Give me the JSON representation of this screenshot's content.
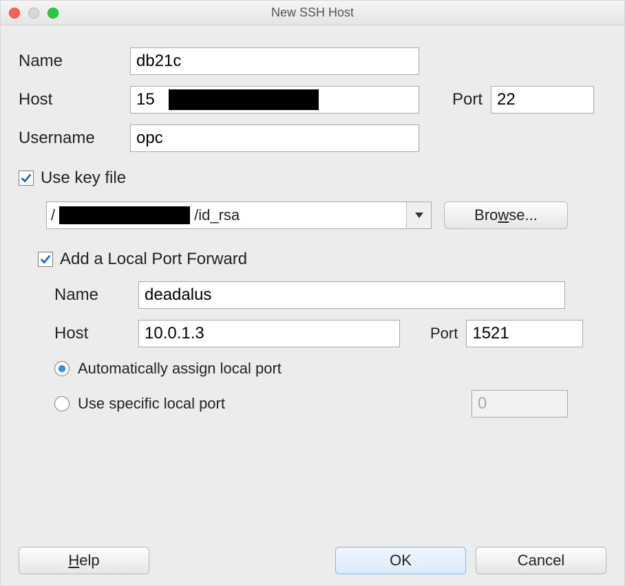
{
  "window": {
    "title": "New SSH Host"
  },
  "labels": {
    "name": "Name",
    "host": "Host",
    "port": "Port",
    "username": "Username"
  },
  "values": {
    "name": "db21c",
    "host": "15",
    "port": "22",
    "username": "opc"
  },
  "keyfile": {
    "use_keyfile_label": "Use key file",
    "path_prefix": "/",
    "path_suffix": "/id_rsa",
    "browse_label_prefix": "Bro",
    "browse_label_und": "w",
    "browse_label_suffix": "se..."
  },
  "forward": {
    "add_label": "Add a Local Port Forward",
    "name_label": "Name",
    "host_label": "Host",
    "port_label": "Port",
    "name_value": "deadalus",
    "host_value": "10.0.1.3",
    "port_value": "1521",
    "auto_label": "Automatically assign local port",
    "specific_label": "Use specific local port",
    "specific_value": "0"
  },
  "footer": {
    "help_und": "H",
    "help_rest": "elp",
    "ok": "OK",
    "cancel": "Cancel"
  }
}
